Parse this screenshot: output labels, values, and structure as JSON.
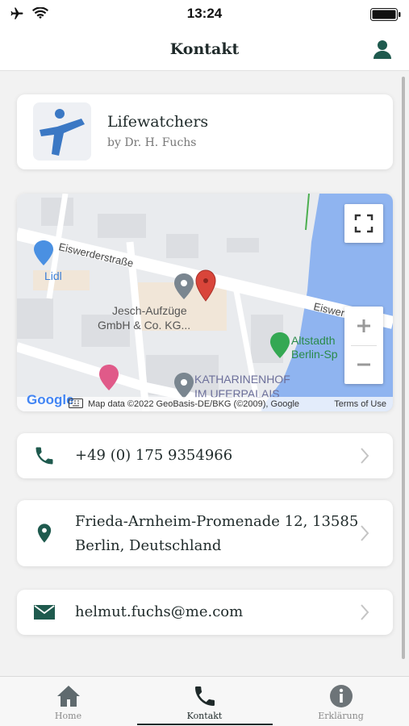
{
  "status_bar": {
    "time": "13:24"
  },
  "nav": {
    "title": "Kontakt"
  },
  "app": {
    "name": "Lifewatchers",
    "author": "by Dr. H. Fuchs"
  },
  "map": {
    "streets": [
      "Eiswerderstraße",
      "Eiswerderstraß"
    ],
    "places": [
      "Lidl",
      "Jesch-Aufzüge",
      "GmbH & Co. KG...",
      "KATHARINENHOF",
      "IM UFERPALAIS",
      "Altstadth",
      "Berlin-Sp"
    ],
    "attribution": "Map data ©2022 GeoBasis-DE/BKG (©2009), Google",
    "terms": "Terms of Use",
    "provider_logo": "Google"
  },
  "contacts": {
    "phone": "+49 (0) 175 9354966",
    "address_line1": "Frieda-Arnheim-Promenade 12, 13585",
    "address_line2": "Berlin, Deutschland",
    "email": "helmut.fuchs@me.com"
  },
  "tabs": [
    {
      "label": "Home",
      "icon": "home-icon",
      "active": false
    },
    {
      "label": "Kontakt",
      "icon": "phone-icon",
      "active": true
    },
    {
      "label": "Erklärung",
      "icon": "info-icon",
      "active": false
    }
  ],
  "colors": {
    "accent": "#1f5a4e",
    "map_water": "#8fb4f0",
    "map_land": "#e9ebee",
    "pin_red": "#d9453a",
    "logo_blue": "#3b78c4"
  }
}
